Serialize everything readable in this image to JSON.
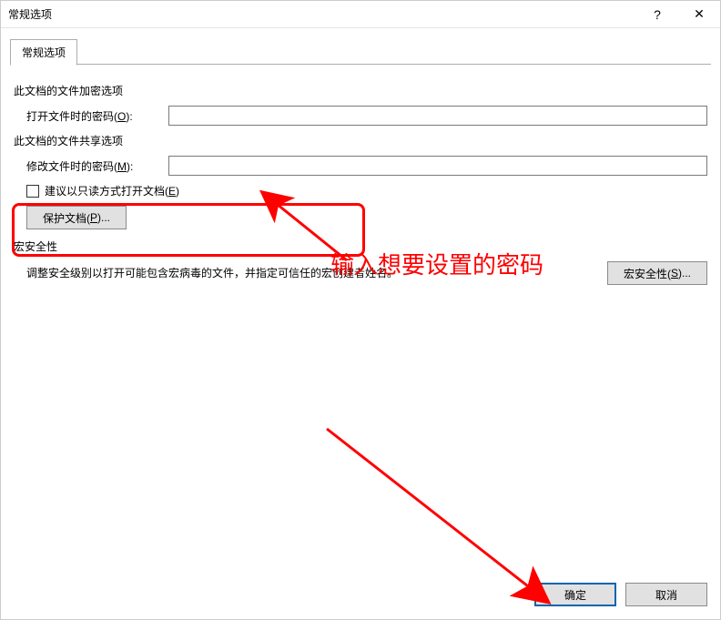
{
  "window": {
    "title": "常规选项",
    "help_label": "?",
    "close_label": "✕",
    "tab_label": "常规选项"
  },
  "sections": {
    "encrypt_label": "此文档的文件加密选项",
    "open_pw_label_pre": "打开文件时的密码(",
    "open_pw_mn": "O",
    "open_pw_label_post": "):",
    "open_pw_value": "",
    "share_label": "此文档的文件共享选项",
    "modify_pw_label_pre": "修改文件时的密码(",
    "modify_pw_mn": "M",
    "modify_pw_label_post": "):",
    "modify_pw_value": "",
    "readonly_label_pre": "建议以只读方式打开文档(",
    "readonly_mn": "E",
    "readonly_label_post": ")",
    "protect_btn_pre": "保护文档(",
    "protect_btn_mn": "P",
    "protect_btn_post": ")...",
    "macro_sec_label": "宏安全性",
    "macro_desc": "调整安全级别以打开可能包含宏病毒的文件，并指定可信任的宏创建者姓名。",
    "macro_btn_pre": "宏安全性(",
    "macro_btn_mn": "S",
    "macro_btn_post": ")..."
  },
  "footer": {
    "ok_label": "确定",
    "cancel_label": "取消"
  },
  "annotation": {
    "text": "输入想要设置的密码"
  }
}
